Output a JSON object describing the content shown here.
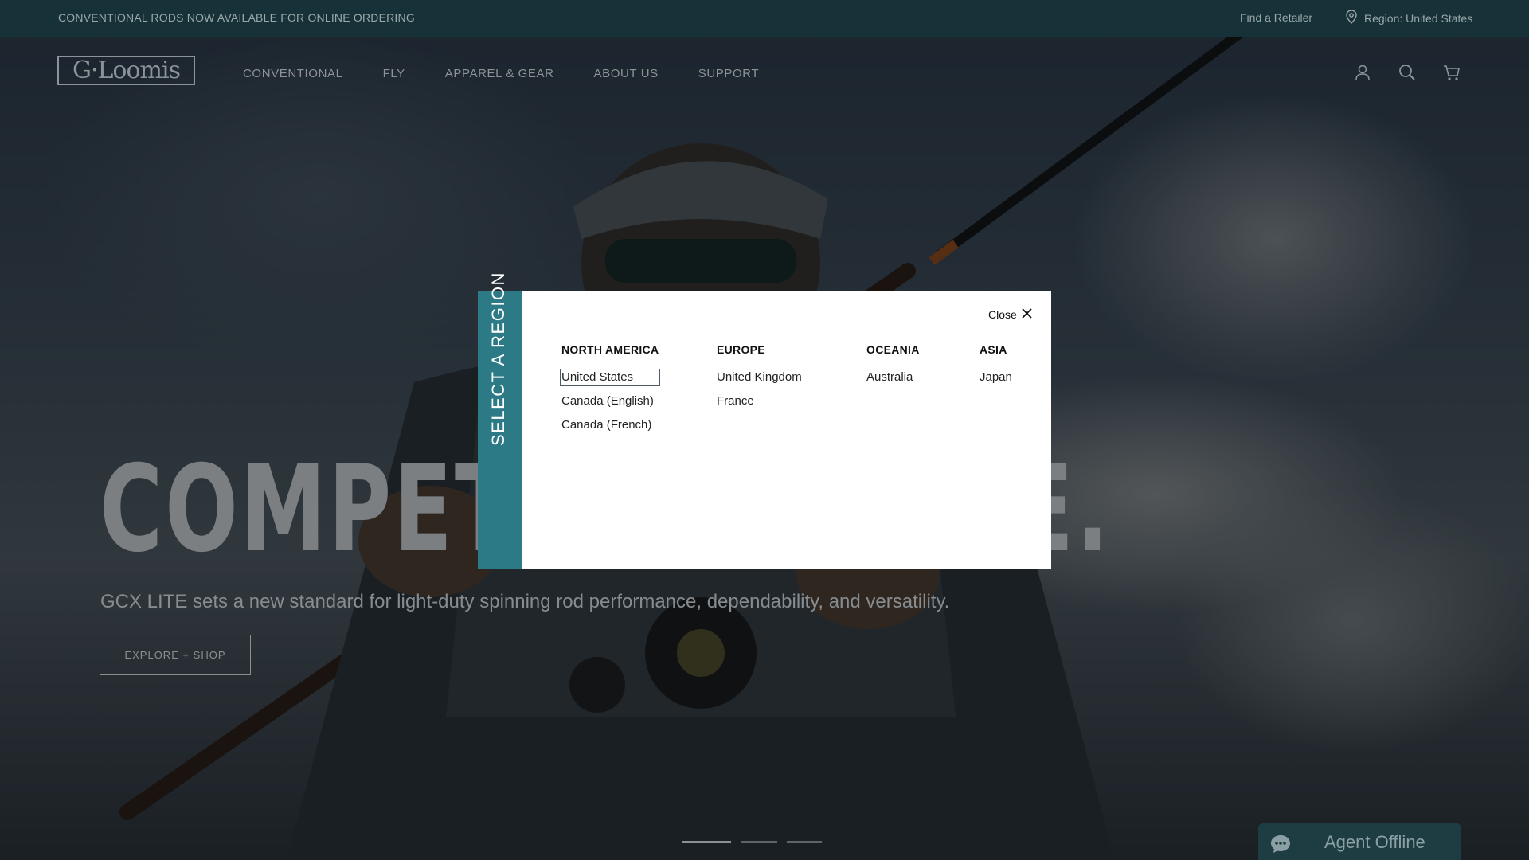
{
  "announcement": "CONVENTIONAL RODS NOW AVAILABLE FOR ONLINE ORDERING",
  "utility": {
    "find_retailer": "Find a Retailer",
    "region_label": "Region: United States"
  },
  "brand": {
    "logo_text": "G·Loomis"
  },
  "nav": {
    "items": [
      {
        "label": "CONVENTIONAL"
      },
      {
        "label": "FLY"
      },
      {
        "label": "APPAREL & GEAR"
      },
      {
        "label": "ABOUT US"
      },
      {
        "label": "SUPPORT"
      }
    ]
  },
  "header_icons": [
    "account-icon",
    "search-icon",
    "cart-icon"
  ],
  "hero": {
    "headline": "COMPETITIVE EDGE.",
    "subhead": "GCX LITE sets a new standard for light-duty spinning rod performance, dependability, and versatility.",
    "cta_label": "EXPLORE + SHOP",
    "slides": 3,
    "active_slide": 1
  },
  "modal": {
    "side_title": "SELECT A REGION",
    "close_label": "Close",
    "selected_region": "United States",
    "columns": [
      {
        "title": "NORTH AMERICA",
        "regions": [
          "United States",
          "Canada (English)",
          "Canada (French)"
        ]
      },
      {
        "title": "EUROPE",
        "regions": [
          "United Kingdom",
          "France"
        ]
      },
      {
        "title": "OCEANIA",
        "regions": [
          "Australia"
        ]
      },
      {
        "title": "ASIA",
        "regions": [
          "Japan"
        ]
      }
    ]
  },
  "chat": {
    "label": "Agent Offline",
    "icon": "chat-bubble-icon"
  },
  "colors": {
    "topbar": "#163238",
    "modal_accent": "#2c7a86",
    "chat": "#1d3d43"
  }
}
